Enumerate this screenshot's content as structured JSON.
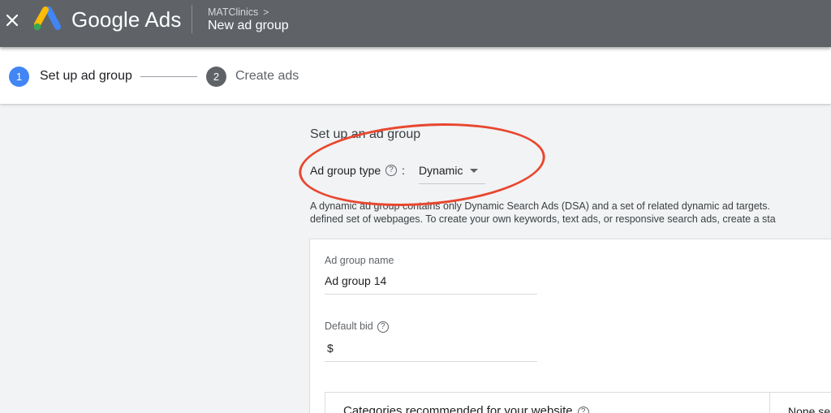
{
  "header": {
    "brand": "Google Ads",
    "breadcrumb_parent": "MATClinics",
    "breadcrumb_chevron": ">",
    "breadcrumb_current": "New ad group"
  },
  "stepper": {
    "steps": [
      {
        "number": "1",
        "label": "Set up ad group",
        "state": "active"
      },
      {
        "number": "2",
        "label": "Create ads",
        "state": "inactive"
      }
    ]
  },
  "main": {
    "section_title": "Set up an ad group",
    "ad_group_type": {
      "label": "Ad group type",
      "help": "?",
      "colon": ":",
      "value": "Dynamic"
    },
    "description": [
      "A dynamic ad group contains only Dynamic Search Ads (DSA) and a set of related dynamic ad targets.",
      "defined set of webpages. To create your own keywords, text ads, or responsive search ads, create a sta"
    ],
    "form": {
      "name_label": "Ad group name",
      "name_value": "Ad group 14",
      "bid_label": "Default bid",
      "bid_help": "?",
      "bid_value": "$",
      "categories_title": "Categories recommended for your website",
      "categories_help": "?",
      "categories_side": "None sel"
    }
  },
  "colors": {
    "topbar": "#5f6368",
    "step_active": "#4285f4",
    "step_inactive": "#5f6368",
    "annotation": "#e8472f"
  }
}
